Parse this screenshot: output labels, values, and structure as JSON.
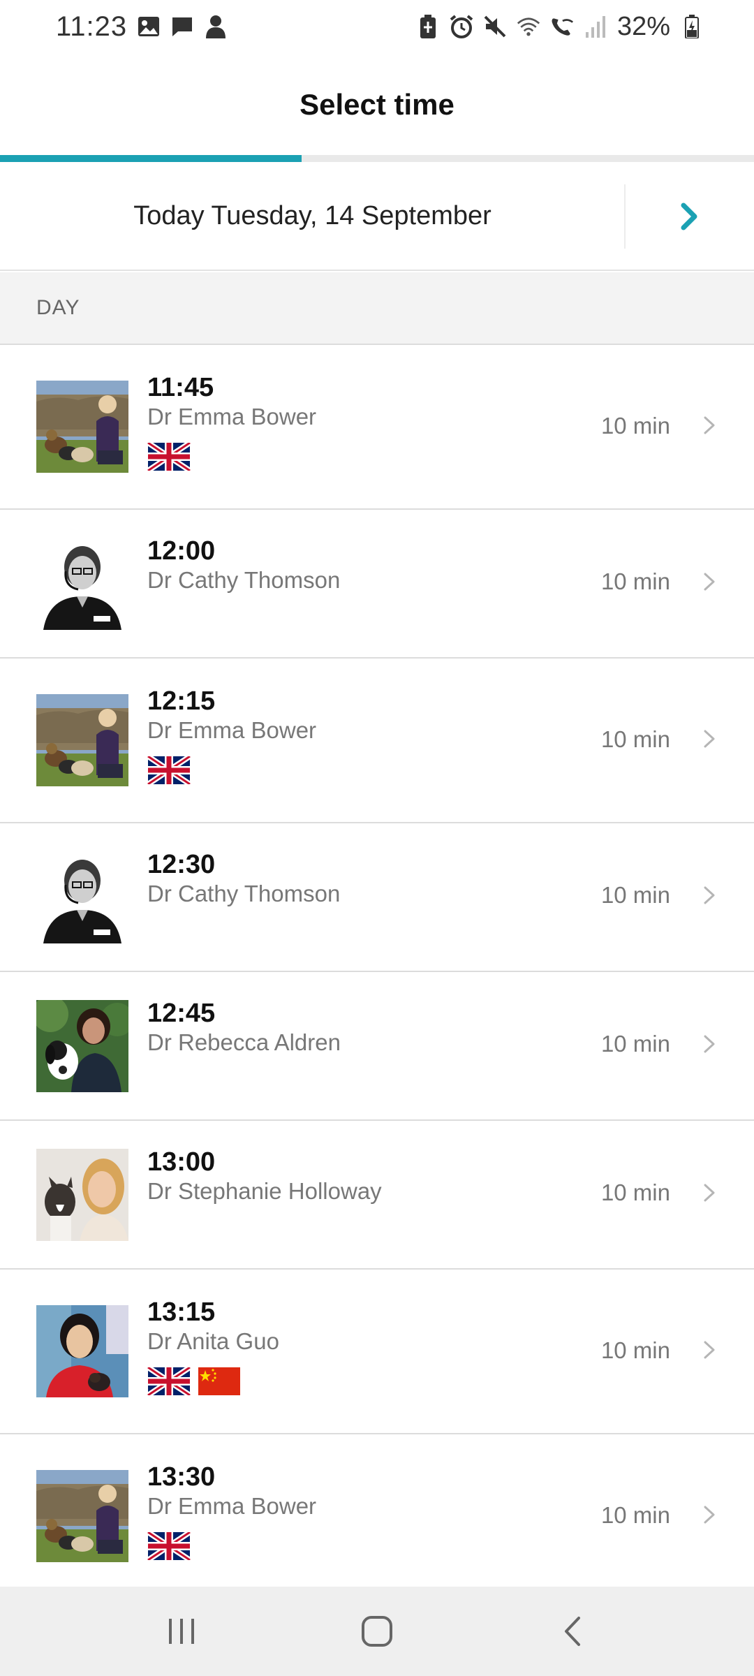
{
  "status_bar": {
    "time": "11:23",
    "battery": "32%",
    "left_icons": [
      "image-icon",
      "message-icon",
      "person-icon"
    ],
    "right_icons": [
      "battery-saver-icon",
      "alarm-icon",
      "mute-icon",
      "wifi-icon",
      "wifi-call-icon",
      "signal-icon",
      "battery-icon"
    ]
  },
  "header": {
    "title": "Select time",
    "progress": 0.4
  },
  "date_selector": {
    "label": "Today Tuesday, 14 September",
    "next_icon": "chevron-right-icon"
  },
  "section": {
    "label": "DAY"
  },
  "slots": [
    {
      "time": "11:45",
      "doctor": "Dr Emma Bower",
      "duration": "10 min",
      "flags": [
        "uk"
      ],
      "avatar": "emma"
    },
    {
      "time": "12:00",
      "doctor": "Dr Cathy Thomson",
      "duration": "10 min",
      "flags": [],
      "avatar": "cathy"
    },
    {
      "time": "12:15",
      "doctor": "Dr Emma Bower",
      "duration": "10 min",
      "flags": [
        "uk"
      ],
      "avatar": "emma"
    },
    {
      "time": "12:30",
      "doctor": "Dr Cathy Thomson",
      "duration": "10 min",
      "flags": [],
      "avatar": "cathy"
    },
    {
      "time": "12:45",
      "doctor": "Dr Rebecca Aldren",
      "duration": "10 min",
      "flags": [],
      "avatar": "rebecca"
    },
    {
      "time": "13:00",
      "doctor": "Dr Stephanie Holloway",
      "duration": "10 min",
      "flags": [],
      "avatar": "stephanie"
    },
    {
      "time": "13:15",
      "doctor": "Dr Anita Guo",
      "duration": "10 min",
      "flags": [
        "uk",
        "china"
      ],
      "avatar": "anita"
    },
    {
      "time": "13:30",
      "doctor": "Dr Emma Bower",
      "duration": "10 min",
      "flags": [
        "uk"
      ],
      "avatar": "emma"
    }
  ],
  "nav_bar": {
    "buttons": [
      "recents-icon",
      "home-icon",
      "back-icon"
    ]
  },
  "colors": {
    "accent": "#1ba1b3",
    "divider": "#dcdcdc",
    "section_bg": "#f3f3f3"
  }
}
